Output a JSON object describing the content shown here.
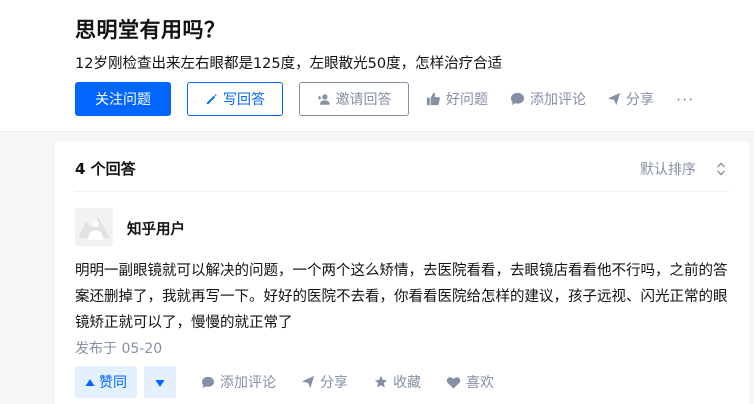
{
  "question": {
    "title": "思明堂有用吗？",
    "detail": "12岁刚检查出来左右眼都是125度，左眼散光50度，怎样治疗合适",
    "actions": {
      "follow": "关注问题",
      "write": "写回答",
      "invite": "邀请回答",
      "good": "好问题",
      "comment": "添加评论",
      "share": "分享",
      "more": "···"
    }
  },
  "answers": {
    "count_label": "4 个回答",
    "sort_label": "默认排序",
    "items": [
      {
        "author": "知乎用户",
        "content": "明明一副眼镜就可以解决的问题，一个两个这么矫情，去医院看看，去眼镜店看看他不行吗，之前的答案还删掉了，我就再写一下。好好的医院不去看，你看看医院给怎样的建议，孩子远视、闪光正常的眼镜矫正就可以了，慢慢的就正常了",
        "date": "发布于 05-20",
        "vote_up": "赞同",
        "comment": "添加评论",
        "share": "分享",
        "collect": "收藏",
        "like": "喜欢"
      }
    ]
  },
  "colors": {
    "primary": "#0066ff",
    "secondary_text": "#8590a6",
    "vote_bg": "#e5f0ff"
  },
  "icons": [
    "pen-icon",
    "invite-icon",
    "thumb-up-icon",
    "comment-icon",
    "share-icon",
    "sort-icon",
    "triangle-up-icon",
    "triangle-down-icon",
    "star-icon",
    "heart-icon",
    "avatar-icon"
  ]
}
